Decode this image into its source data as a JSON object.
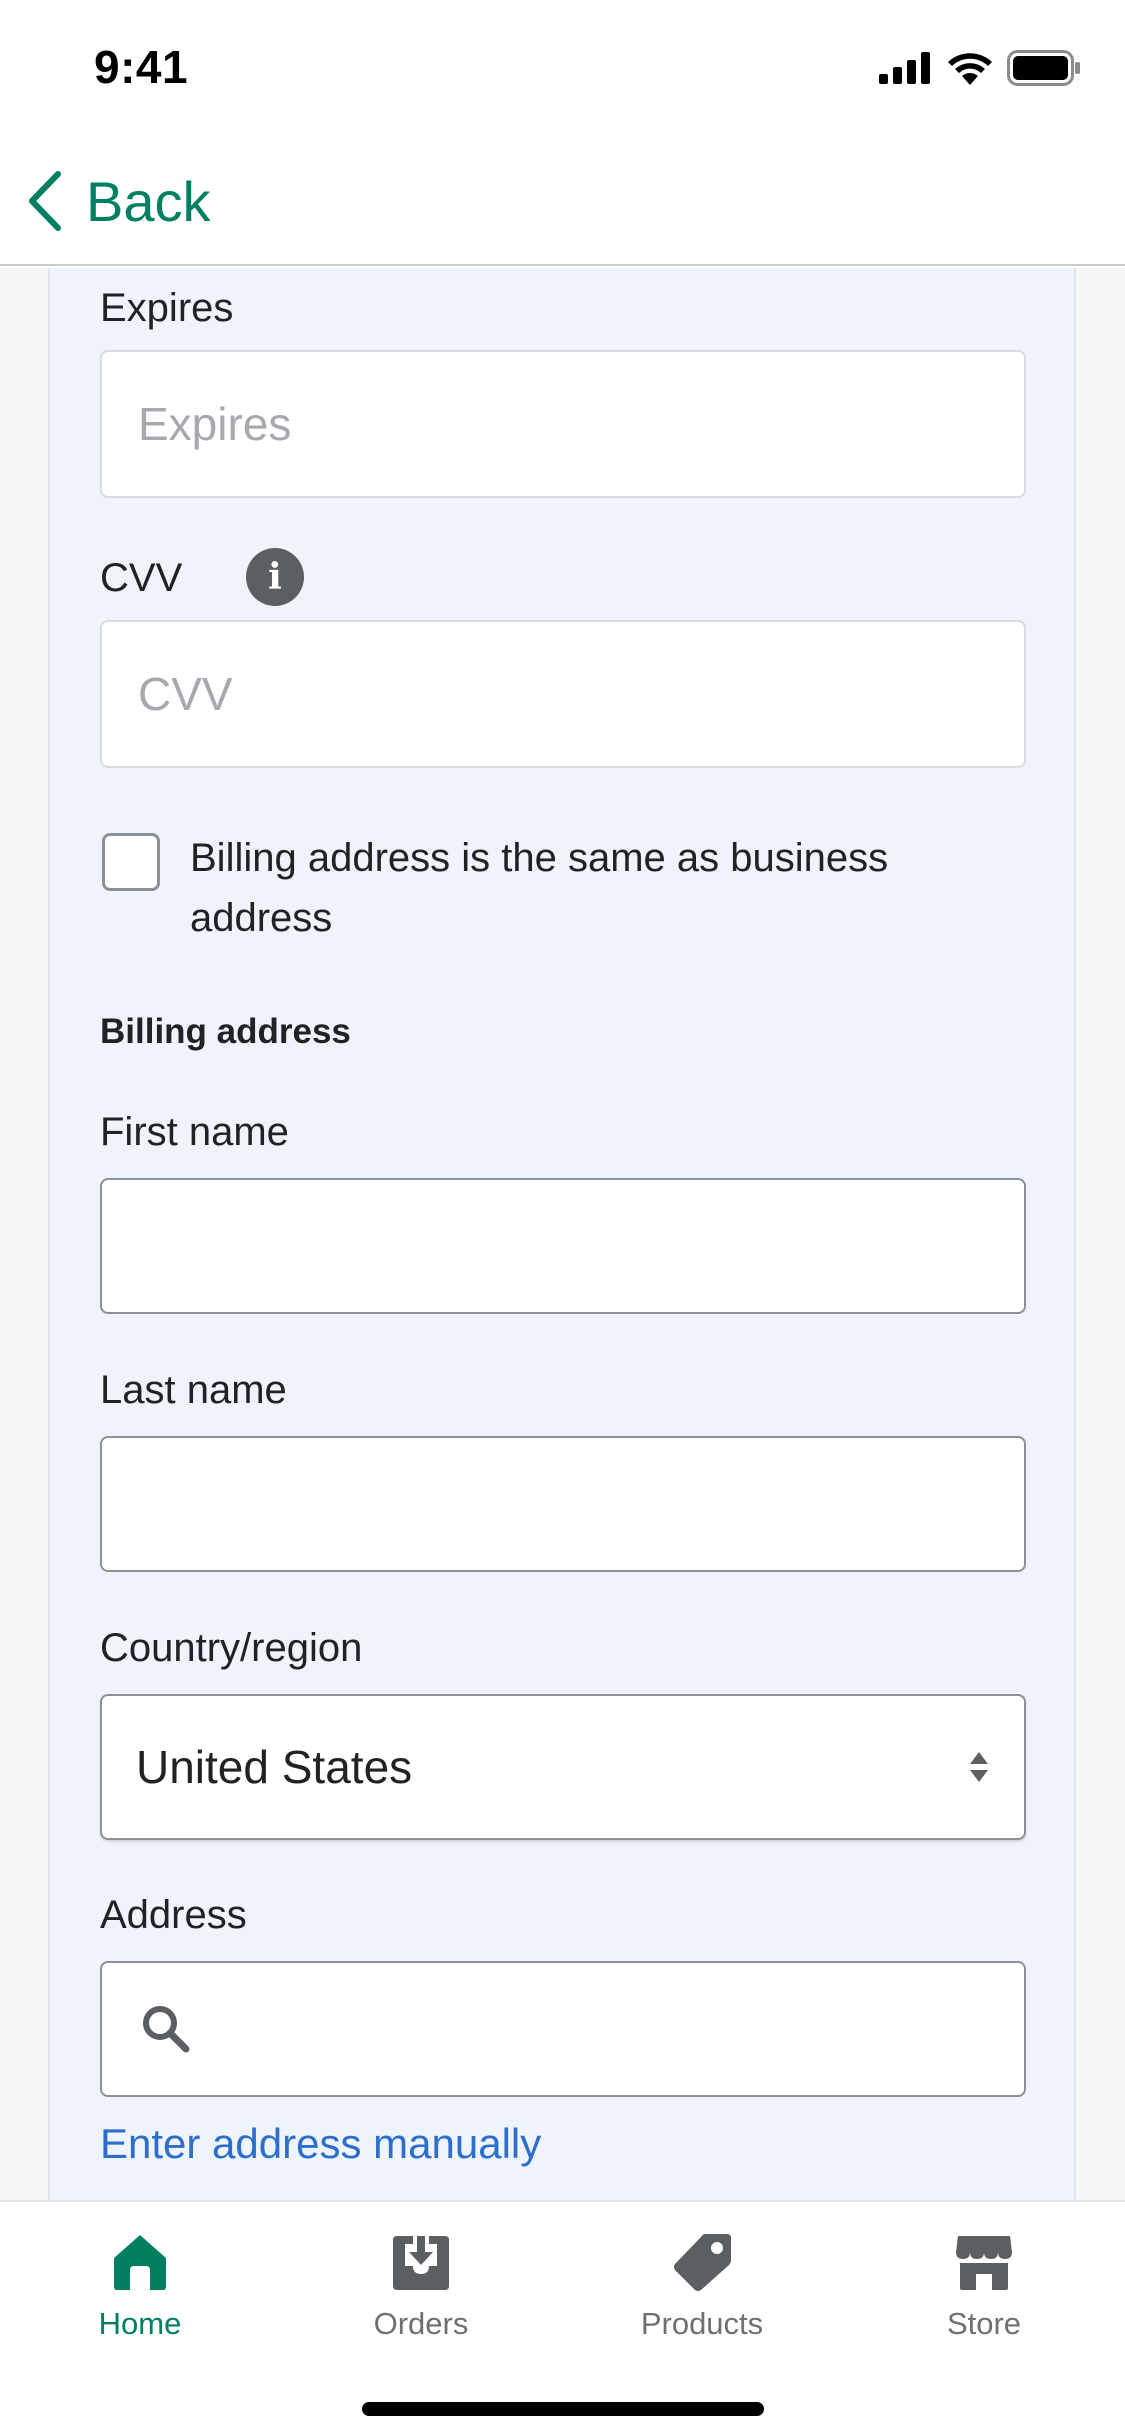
{
  "status_bar": {
    "time": "9:41"
  },
  "nav": {
    "back_label": "Back"
  },
  "form": {
    "expires": {
      "label": "Expires",
      "placeholder": "Expires"
    },
    "cvv": {
      "label": "CVV",
      "placeholder": "CVV",
      "info_glyph": "i"
    },
    "same_address": {
      "label": "Billing address is the same as business address",
      "checked": false
    },
    "billing_title": "Billing address",
    "first_name": {
      "label": "First name",
      "value": ""
    },
    "last_name": {
      "label": "Last name",
      "value": ""
    },
    "country": {
      "label": "Country/region",
      "value": "United States"
    },
    "address": {
      "label": "Address",
      "value": ""
    },
    "manual_link": "Enter address manually"
  },
  "tabs": [
    {
      "label": "Home",
      "icon": "home-icon",
      "active": true
    },
    {
      "label": "Orders",
      "icon": "orders-inbox-icon",
      "active": false
    },
    {
      "label": "Products",
      "icon": "tag-icon",
      "active": false
    },
    {
      "label": "Store",
      "icon": "store-icon",
      "active": false
    }
  ],
  "colors": {
    "accent": "#008060",
    "link": "#2c6ecb",
    "panel_background": "#eff3fc",
    "icon_inactive": "#5c5f62"
  }
}
